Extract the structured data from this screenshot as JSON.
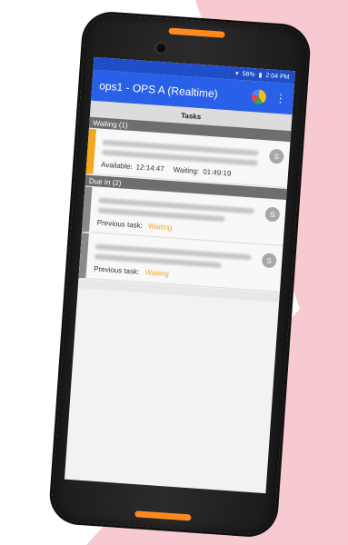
{
  "status": {
    "battery": "56%",
    "time": "2:04 PM"
  },
  "app": {
    "title": "ops1 - OPS A  (Realtime)",
    "more_icon": "⋮"
  },
  "tasks": {
    "title": "Tasks"
  },
  "waiting": {
    "header": "Waiting (1)",
    "card": {
      "badge": "S",
      "available_label": "Available:",
      "available_value": "12:14:47",
      "waiting_label": "Waiting:",
      "waiting_value": "01:49:19"
    }
  },
  "due_in": {
    "header": "Due In (2)",
    "cards": [
      {
        "badge": "S",
        "prev_label": "Previous task:",
        "prev_value": "Waiting"
      },
      {
        "badge": "S",
        "prev_label": "Previous task:",
        "prev_value": "Waiting"
      }
    ]
  },
  "colors": {
    "appbar": "#2960e8",
    "accent": "#f3a81c"
  }
}
